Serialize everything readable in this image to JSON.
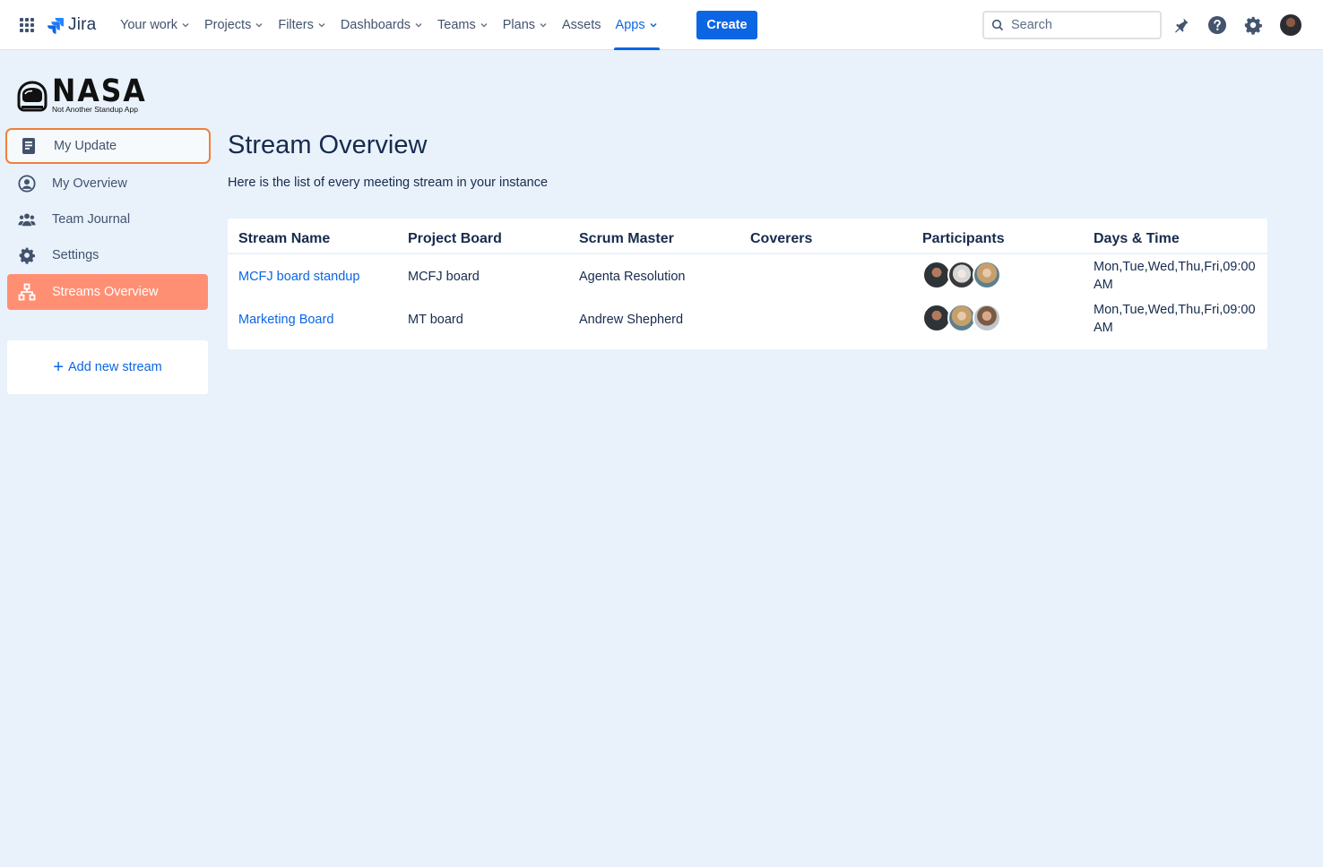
{
  "topnav": {
    "product": "Jira",
    "items": [
      {
        "label": "Your work",
        "dropdown": true
      },
      {
        "label": "Projects",
        "dropdown": true
      },
      {
        "label": "Filters",
        "dropdown": true
      },
      {
        "label": "Dashboards",
        "dropdown": true
      },
      {
        "label": "Teams",
        "dropdown": true
      },
      {
        "label": "Plans",
        "dropdown": true
      },
      {
        "label": "Assets",
        "dropdown": false
      },
      {
        "label": "Apps",
        "dropdown": true,
        "active": true
      }
    ],
    "create_label": "Create",
    "search_placeholder": "Search",
    "icons": [
      "app-switcher-icon",
      "notifications-icon",
      "help-icon",
      "settings-icon",
      "profile-avatar"
    ]
  },
  "sidebar": {
    "brand_name": "NASA",
    "brand_tagline": "Not Another Standup App",
    "items": [
      {
        "label": "My Update",
        "icon": "document-icon",
        "state": "focused"
      },
      {
        "label": "My Overview",
        "icon": "user-circle-icon",
        "state": "normal"
      },
      {
        "label": "Team Journal",
        "icon": "people-icon",
        "state": "normal"
      },
      {
        "label": "Settings",
        "icon": "gear-icon",
        "state": "normal"
      },
      {
        "label": "Streams Overview",
        "icon": "hierarchy-icon",
        "state": "active"
      }
    ],
    "add_stream_label": "Add new stream"
  },
  "main": {
    "title": "Stream Overview",
    "description": "Here is the list of every meeting stream in your instance",
    "table": {
      "columns": [
        "Stream Name",
        "Project Board",
        "Scrum Master",
        "Coverers",
        "Participants",
        "Days & Time"
      ],
      "rows": [
        {
          "stream_name": "MCFJ board standup",
          "project_board": "MCFJ board",
          "scrum_master": "Agenta Resolution",
          "coverers": "",
          "participants": 3,
          "days_time": "Mon,Tue,Wed,Thu,Fri,09:00 AM"
        },
        {
          "stream_name": "Marketing Board",
          "project_board": "MT board",
          "scrum_master": "Andrew Shepherd",
          "coverers": "",
          "participants": 3,
          "days_time": "Mon,Tue,Wed,Thu,Fri,09:00 AM"
        }
      ]
    }
  },
  "colors": {
    "accent": "#0c66e4",
    "active_menu": "#ff8f73",
    "focus_outline": "#f0803c",
    "page_background": "#e9f2fb"
  }
}
